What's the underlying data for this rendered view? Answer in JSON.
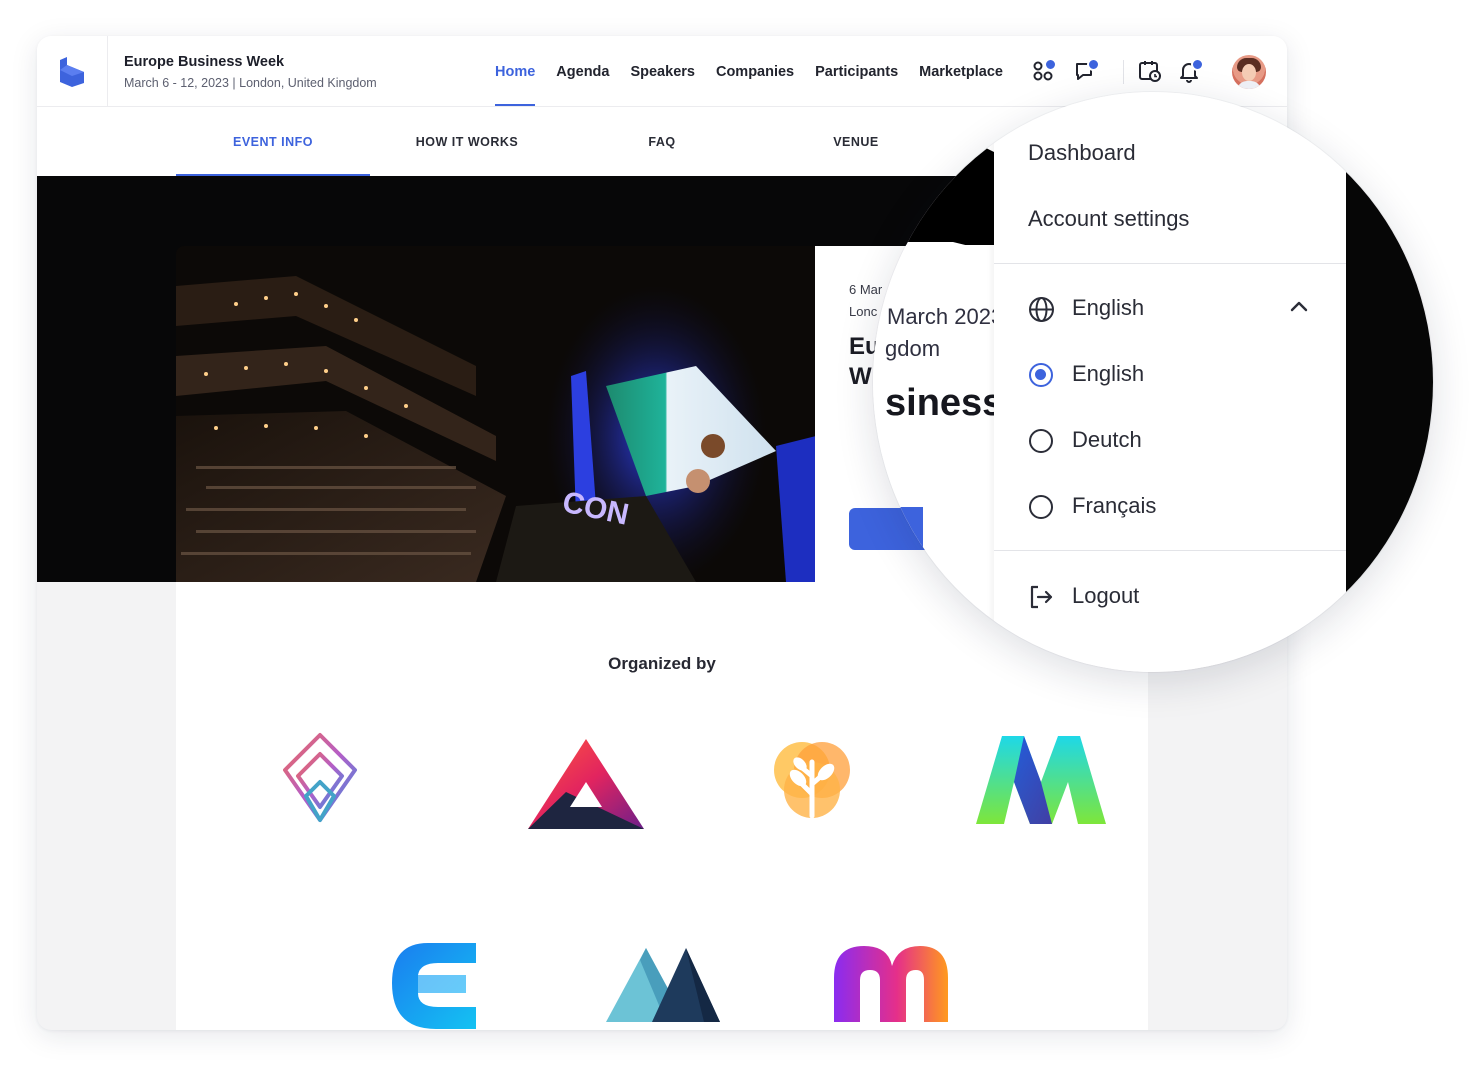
{
  "header": {
    "event_title": "Europe Business Week",
    "event_subtitle": "March 6 - 12, 2023 | London, United Kingdom",
    "nav": [
      "Home",
      "Agenda",
      "Speakers",
      "Companies",
      "Participants",
      "Marketplace"
    ],
    "active_nav": "Home",
    "icons": [
      "apps-icon",
      "chat-icon",
      "calendar-icon",
      "bell-icon"
    ],
    "accent_color": "#3d63dd"
  },
  "subtabs": [
    "EVENT INFO",
    "HOW IT WORKS",
    "FAQ",
    "VENUE"
  ],
  "hero": {
    "date_partial": "6 Mar",
    "location_partial": "Lonc",
    "title_partial_1": "Eu",
    "title_partial_2": "W"
  },
  "content": {
    "organized_by": "Organized by"
  },
  "magnifier": {
    "date_fragment": "March 2023",
    "location_fragment": "gdom",
    "title_fragment": "siness",
    "menu": {
      "dashboard": "Dashboard",
      "account_settings": "Account settings",
      "language_current": "English",
      "languages": [
        {
          "label": "English",
          "selected": true
        },
        {
          "label": "Deutch",
          "selected": false
        },
        {
          "label": "Français",
          "selected": false
        }
      ],
      "logout": "Logout"
    }
  }
}
